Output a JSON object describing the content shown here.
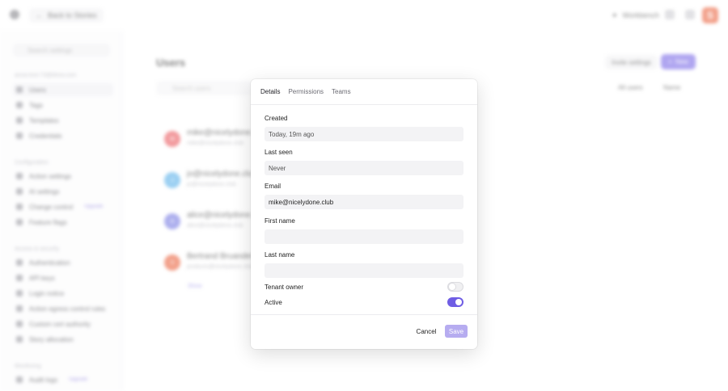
{
  "topbar": {
    "back_label": "Back to Stories",
    "workbench_label": "Workbench",
    "brand_glyph": "S",
    "brand_color": "#e8542c"
  },
  "sidebar": {
    "search_placeholder": "Search settings",
    "tenant_section": "anna-test-73@drew.com",
    "users": "Users",
    "tags": "Tags",
    "templates": "Templates",
    "credentials": "Credentials",
    "config_section": "Configuration",
    "action_settings": "Action settings",
    "ai_settings": "AI settings",
    "change_control": "Change control",
    "change_control_badge": "Upgrade",
    "feature_flags": "Feature flags",
    "access_section": "Access & security",
    "authentication": "Authentication",
    "api_keys": "API keys",
    "login_notice": "Login notice",
    "action_egress": "Action egress control rules",
    "custom_cert": "Custom cert authority",
    "story_allocation": "Story allocation",
    "monitoring_section": "Monitoring",
    "audit_logs": "Audit logs",
    "audit_logs_badge": "Upgrade"
  },
  "main": {
    "title": "Users",
    "search_placeholder": "Search users",
    "invite_label": "Invite settings",
    "new_label": "New",
    "filter_all": "All users",
    "filter_name": "Name",
    "users": [
      {
        "name": "mike@nicelydone.club",
        "email": "mike@nicelydone.club",
        "initial": "M",
        "color": "#e8494f"
      },
      {
        "name": "jo@nicelydone.club",
        "email": "jo@nicelydone.club",
        "initial": "J",
        "color": "#4aa9e8"
      },
      {
        "name": "alice@nicelydone.club",
        "email": "alice@nicelydone.club",
        "initial": "A",
        "color": "#6b6fe0"
      },
      {
        "name": "Bertrand Bruandet",
        "email": "products@nicelydone.club",
        "initial": "S",
        "color": "#e8542c"
      }
    ],
    "bottom_link": "Show"
  },
  "modal": {
    "tabs": {
      "details": "Details",
      "permissions": "Permissions",
      "teams": "Teams"
    },
    "created_label": "Created",
    "created_value": "Today, 19m ago",
    "last_seen_label": "Last seen",
    "last_seen_value": "Never",
    "email_label": "Email",
    "email_value": "mike@nicelydone.club",
    "first_name_label": "First name",
    "first_name_value": "",
    "last_name_label": "Last name",
    "last_name_value": "",
    "tenant_owner_label": "Tenant owner",
    "tenant_owner_on": false,
    "active_label": "Active",
    "active_on": true,
    "cancel_label": "Cancel",
    "save_label": "Save",
    "accent_color": "#6f5de4"
  }
}
